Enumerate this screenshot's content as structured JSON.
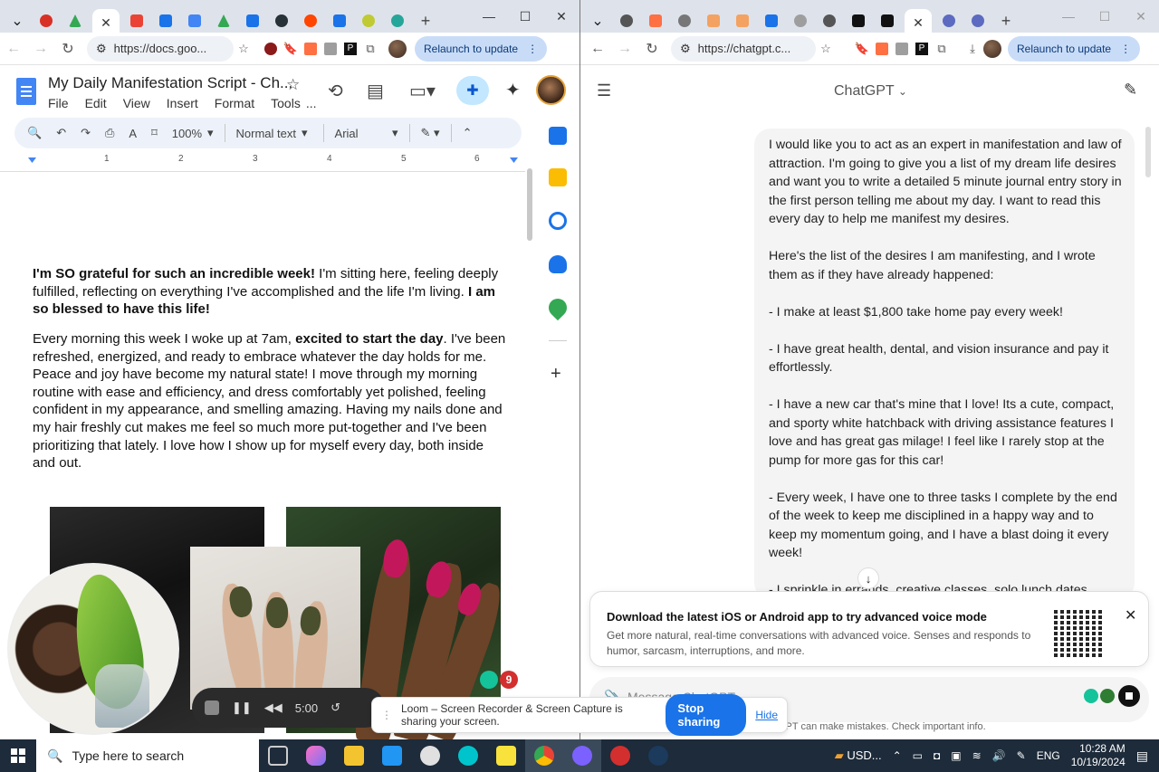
{
  "left_browser": {
    "url": "https://docs.goo...",
    "relaunch": "Relaunch to update",
    "tab_letters": [
      "P"
    ]
  },
  "docs": {
    "title": "My Daily Manifestation Script - Ch...",
    "menu": [
      "File",
      "Edit",
      "View",
      "Insert",
      "Format",
      "Tools",
      "..."
    ],
    "zoom": "100%",
    "style": "Normal text",
    "font": "Arial",
    "ruler_ticks": [
      "1",
      "2",
      "3",
      "4",
      "5",
      "6"
    ],
    "p1_bold_a": "I'm SO grateful for such an incredible week!",
    "p1_text": " I'm sitting here, feeling deeply fulfilled, reflecting on everything I've accomplished and the life I'm living. ",
    "p1_bold_b": "I am so blessed to have this life!",
    "p2_a": "Every morning this week I woke up at 7am, ",
    "p2_bold": "excited to start the day",
    "p2_b": ". I've been refreshed, energized, and ready to embrace whatever the day holds for me. Peace and joy have become my natural state! I move through my morning routine with ease and efficiency, and dress comfortably yet polished, feeling confident in my appearance, and smelling amazing. Having my nails done and my hair freshly cut makes me feel so much more put-together and I've been prioritizing that lately. I love how I show up for myself every day, both inside and out."
  },
  "loom": {
    "time": "5:00",
    "badge": "9",
    "share_text": "Loom – Screen Recorder & Screen Capture is sharing your screen.",
    "stop": "Stop sharing",
    "hide": "Hide"
  },
  "right_browser": {
    "url": "https://chatgpt.c...",
    "relaunch": "Relaunch to update"
  },
  "chat": {
    "title": "ChatGPT",
    "message": "I would like you to act as an expert in manifestation and law of attraction. I'm going to give you a list of my dream life desires and want you to write a detailed 5 minute journal entry story in the first person telling me about my day. I want to read this every day to help me manifest my desires.\n\nHere's the list of the desires I am manifesting, and I wrote them as if they have already happened:\n\n- I make at least $1,800 take home pay every week!\n\n- I have great health, dental, and vision insurance and pay it effortlessly.\n\n- I have a new car that's mine that I love! Its a cute, compact, and sporty white hatchback with driving assistance features I love and has great gas milage! I feel like I rarely stop at the pump for more gas for this car!\n\n- Every week, I have one to three tasks I complete by the end of the week to keep me disciplined in a happy way and to keep my momentum going, and I have a blast doing it every week!\n\n- I sprinkle in errands, creative classes, solo lunch dates, movement classes, and personal maintence appointments",
    "notif_title": "Download the latest iOS or Android app to try advanced voice mode",
    "notif_body": "Get more natural, real-time conversations with advanced voice. Senses and responds to humor, sarcasm, interruptions, and more.",
    "placeholder": "Message ChatGPT",
    "disclaimer": "GPT can make mistakes. Check important info."
  },
  "taskbar": {
    "search": "Type here to search",
    "currency": "USD...",
    "lang": "ENG",
    "time": "10:28 AM",
    "date": "10/19/2024"
  }
}
